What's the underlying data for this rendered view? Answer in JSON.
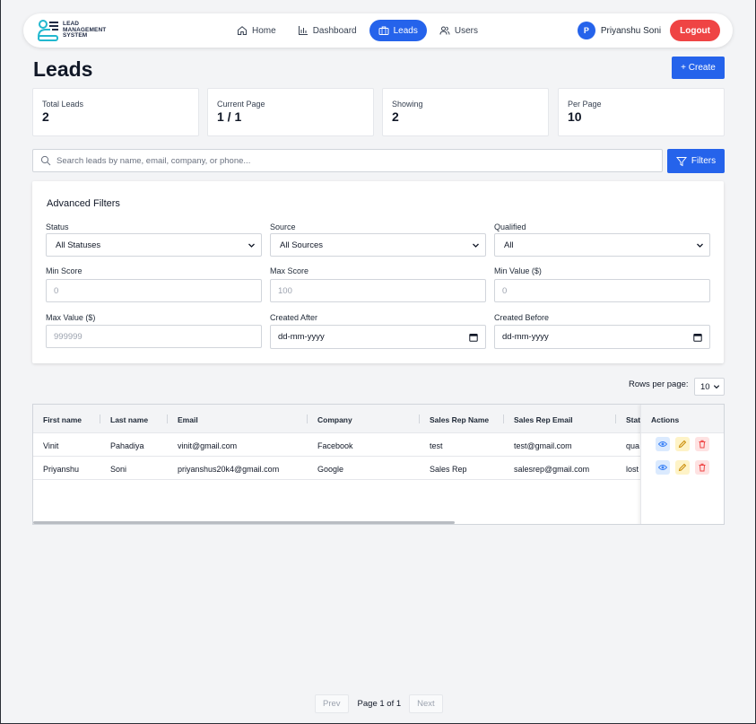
{
  "app": {
    "logo_lines": [
      "LEAD",
      "MANAGEMENT",
      "SYSTEM"
    ]
  },
  "nav": {
    "items": [
      {
        "label": "Home",
        "icon": "home-icon",
        "active": false
      },
      {
        "label": "Dashboard",
        "icon": "bar-chart-icon",
        "active": false
      },
      {
        "label": "Leads",
        "icon": "briefcase-icon",
        "active": true
      },
      {
        "label": "Users",
        "icon": "users-icon",
        "active": false
      }
    ],
    "user": {
      "initial": "P",
      "name": "Priyanshu Soni"
    },
    "logout_label": "Logout"
  },
  "header": {
    "title": "Leads",
    "create_label": "+ Create"
  },
  "stats": [
    {
      "label": "Total Leads",
      "value": "2"
    },
    {
      "label": "Current Page",
      "value": "1 / 1"
    },
    {
      "label": "Showing",
      "value": "2"
    },
    {
      "label": "Per Page",
      "value": "10"
    }
  ],
  "search": {
    "placeholder": "Search leads by name, email, company, or phone...",
    "value": "",
    "filters_label": "Filters"
  },
  "advanced_filters": {
    "title": "Advanced Filters",
    "status": {
      "label": "Status",
      "value": "All Statuses"
    },
    "source": {
      "label": "Source",
      "value": "All Sources"
    },
    "qualified": {
      "label": "Qualified",
      "value": "All"
    },
    "min_score": {
      "label": "Min Score",
      "placeholder": "0"
    },
    "max_score": {
      "label": "Max Score",
      "placeholder": "100"
    },
    "min_value": {
      "label": "Min Value ($)",
      "placeholder": "0"
    },
    "max_value": {
      "label": "Max Value ($)",
      "placeholder": "999999"
    },
    "created_after": {
      "label": "Created After",
      "value": "dd-mm-yyyy"
    },
    "created_before": {
      "label": "Created Before",
      "value": "dd-mm-yyyy"
    }
  },
  "table": {
    "rows_per_page_label": "Rows per page:",
    "rows_per_page_value": "10",
    "columns": [
      "First name",
      "Last name",
      "Email",
      "Company",
      "Sales Rep Name",
      "Sales Rep Email",
      "Stat",
      "Actions"
    ],
    "rows": [
      {
        "first": "Vinit",
        "last": "Pahadiya",
        "email": "vinit@gmail.com",
        "company": "Facebook",
        "rep_name": "test",
        "rep_email": "test@gmail.com",
        "status": "qua"
      },
      {
        "first": "Priyanshu",
        "last": "Soni",
        "email": "priyanshus20k4@gmail.com",
        "company": "Google",
        "rep_name": "Sales Rep",
        "rep_email": "salesrep@gmail.com",
        "status": "lost"
      }
    ]
  },
  "pagination": {
    "prev_label": "Prev",
    "info": "Page 1 of 1",
    "next_label": "Next"
  },
  "colors": {
    "primary": "#2563eb",
    "danger": "#ef4444",
    "background": "#f3f4f6"
  }
}
